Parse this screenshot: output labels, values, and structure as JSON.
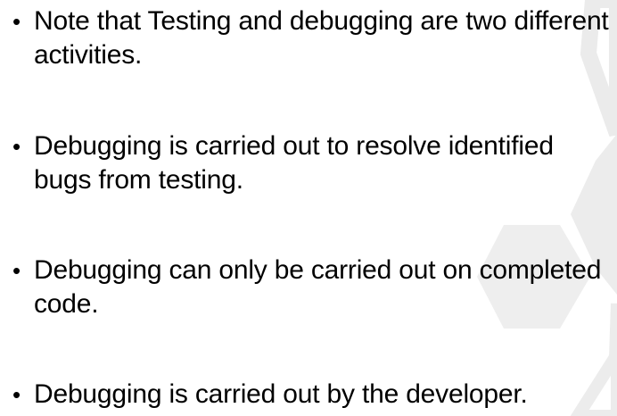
{
  "bullets": [
    {
      "text": "Note that Testing and debugging are two different activities."
    },
    {
      "text": "Debugging is carried out to resolve identified bugs from testing."
    },
    {
      "text": "Debugging can only be carried out on completed code."
    },
    {
      "text": "Debugging is carried out by the developer."
    }
  ],
  "theme": {
    "text_color": "#000000",
    "decoration_color": "#e9e9e9"
  }
}
